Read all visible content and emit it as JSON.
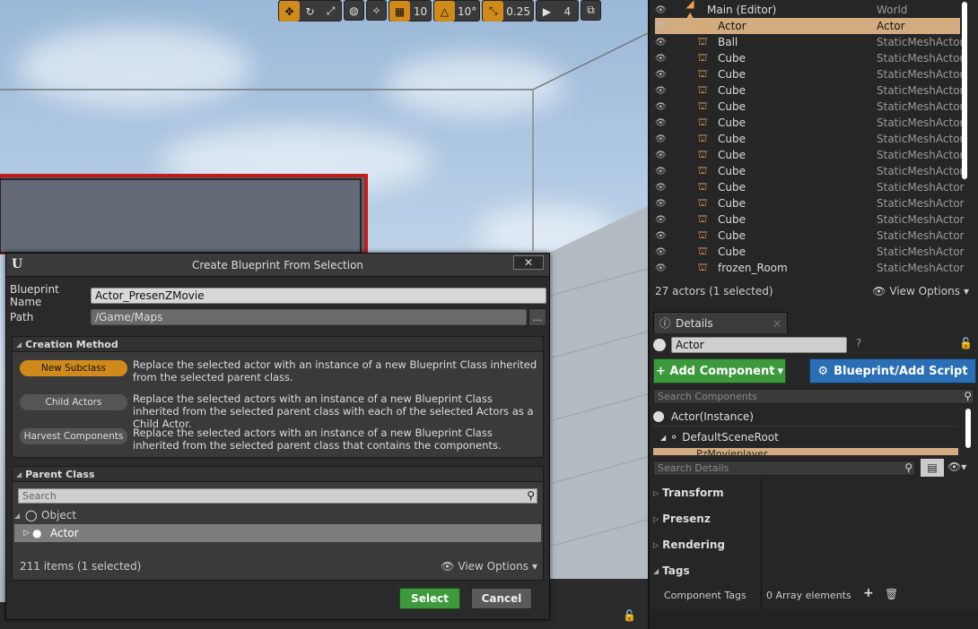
{
  "toolbar": {
    "grid_snap": "10",
    "angle_snap": "10°",
    "scale_snap": "0.25",
    "cam_speed": "4"
  },
  "dialog": {
    "title": "Create Blueprint From Selection",
    "close_label": "✕",
    "name_label": "Blueprint Name",
    "name_value": "Actor_PresenZMovie",
    "path_label": "Path",
    "path_value": "/Game/Maps",
    "ellipsis": "...",
    "creation_method": {
      "header": "Creation Method",
      "options": [
        {
          "label": "New Subclass",
          "desc": "Replace the selected actor with an instance of a new Blueprint Class inherited from the selected parent class."
        },
        {
          "label": "Child Actors",
          "desc": "Replace the selected actors with an instance of a new Blueprint Class inherited from the selected parent class with each of the selected Actors as a Child Actor."
        },
        {
          "label": "Harvest Components",
          "desc": "Replace the selected actors with an instance of a new Blueprint Class inherited from the selected parent class that contains the components."
        }
      ]
    },
    "parent_class": {
      "header": "Parent Class",
      "search_placeholder": "Search",
      "items": [
        {
          "label": "Object"
        },
        {
          "label": "Actor"
        }
      ],
      "status": "211 items (1 selected)",
      "view_options": "View Options"
    },
    "select_label": "Select",
    "cancel_label": "Cancel"
  },
  "outliner": {
    "rows": [
      {
        "name": "Main (Editor)",
        "type": "World"
      },
      {
        "name": "Actor",
        "type": "Actor"
      },
      {
        "name": "Ball",
        "type": "StaticMeshActor"
      },
      {
        "name": "Cube",
        "type": "StaticMeshActor"
      },
      {
        "name": "Cube",
        "type": "StaticMeshActor"
      },
      {
        "name": "Cube",
        "type": "StaticMeshActor"
      },
      {
        "name": "Cube",
        "type": "StaticMeshActor"
      },
      {
        "name": "Cube",
        "type": "StaticMeshActor"
      },
      {
        "name": "Cube",
        "type": "StaticMeshActor"
      },
      {
        "name": "Cube",
        "type": "StaticMeshActor"
      },
      {
        "name": "Cube",
        "type": "StaticMeshActor"
      },
      {
        "name": "Cube",
        "type": "StaticMeshActor"
      },
      {
        "name": "Cube",
        "type": "StaticMeshActor"
      },
      {
        "name": "Cube",
        "type": "StaticMeshActor"
      },
      {
        "name": "Cube",
        "type": "StaticMeshActor"
      },
      {
        "name": "Cube",
        "type": "StaticMeshActor"
      },
      {
        "name": "frozen_Room",
        "type": "StaticMeshActor"
      }
    ],
    "status": "27 actors (1 selected)",
    "view_options": "View Options"
  },
  "details": {
    "tab_label": "Details",
    "actor_name": "Actor",
    "add_component": "+ Add Component",
    "blueprint_script": "Blueprint/Add Script",
    "search_components": "Search Components",
    "instance_label": "Actor(Instance)",
    "root_label": "DefaultSceneRoot",
    "partial_child": "PzMovieplayer",
    "search_details": "Search Details",
    "categories": [
      "Transform",
      "Presenz",
      "Rendering",
      "Tags"
    ],
    "component_tags_label": "Component Tags",
    "array_elements": "0 Array elements"
  }
}
